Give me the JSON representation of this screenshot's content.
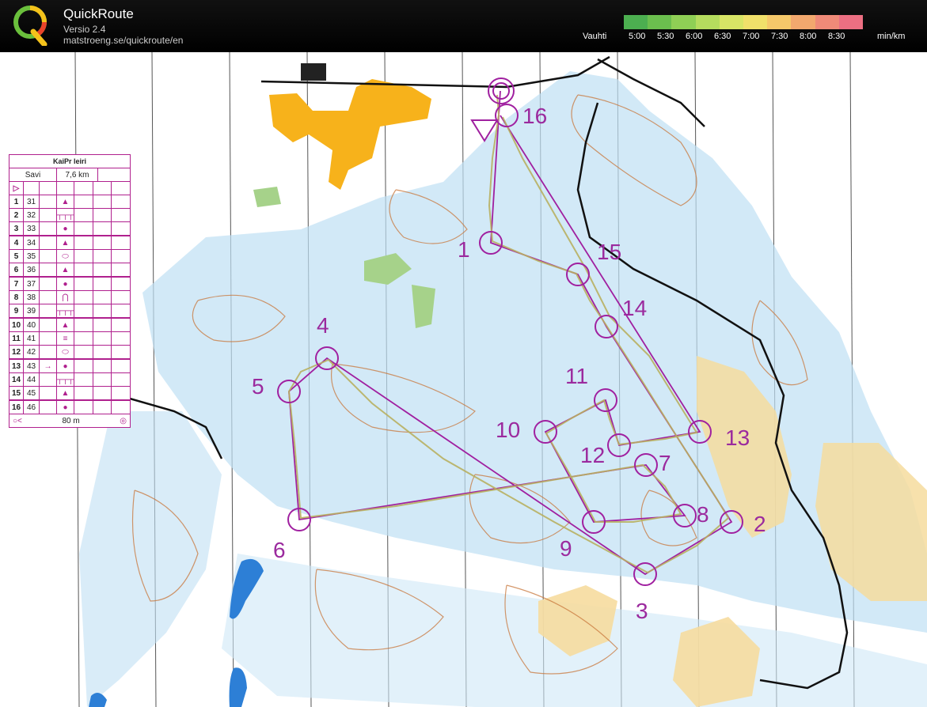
{
  "app": {
    "title": "QuickRoute",
    "version": "Versio 2.4",
    "url": "matstroeng.se/quickroute/en"
  },
  "pace_legend": {
    "label": "Vauhti",
    "ticks": [
      "5:00",
      "5:30",
      "6:00",
      "6:30",
      "7:00",
      "7:30",
      "8:00",
      "8:30"
    ],
    "unit": "min/km",
    "colors": [
      "#4caf50",
      "#6bbf4e",
      "#8fcf55",
      "#b5dc5e",
      "#d8e566",
      "#f0e06a",
      "#f5c86a",
      "#f2a86e",
      "#ef8a78",
      "#ec6f82"
    ]
  },
  "control_card": {
    "event": "KaiPr leiri",
    "course": "Savi",
    "length": "7,6 km",
    "start_symbol": "▷",
    "rows": [
      {
        "num": "1",
        "code": "31",
        "symbol": "▲",
        "extra": ""
      },
      {
        "num": "2",
        "code": "32",
        "symbol": "┬┬┬",
        "extra": ""
      },
      {
        "num": "3",
        "code": "33",
        "symbol": "●",
        "extra": ""
      },
      {
        "num": "4",
        "code": "34",
        "symbol": "▲",
        "extra": ""
      },
      {
        "num": "5",
        "code": "35",
        "symbol": "⬭",
        "extra": ""
      },
      {
        "num": "6",
        "code": "36",
        "symbol": "▲",
        "extra": ""
      },
      {
        "num": "7",
        "code": "37",
        "symbol": "●",
        "extra": ""
      },
      {
        "num": "8",
        "code": "38",
        "symbol": "⋂",
        "extra": ""
      },
      {
        "num": "9",
        "code": "39",
        "symbol": "┬┬┬",
        "extra": ""
      },
      {
        "num": "10",
        "code": "40",
        "symbol": "▲",
        "extra": ""
      },
      {
        "num": "11",
        "code": "41",
        "symbol": "≡",
        "extra": ""
      },
      {
        "num": "12",
        "code": "42",
        "symbol": "⬭",
        "extra": ""
      },
      {
        "num": "13",
        "code": "43",
        "symbol": "●",
        "extra": "→"
      },
      {
        "num": "14",
        "code": "44",
        "symbol": "┬┬┬",
        "extra": ""
      },
      {
        "num": "15",
        "code": "45",
        "symbol": "▲",
        "extra": ""
      },
      {
        "num": "16",
        "code": "46",
        "symbol": "●",
        "extra": ""
      }
    ],
    "finish_distance": "80 m"
  },
  "controls": [
    {
      "label": "1"
    },
    {
      "label": "2"
    },
    {
      "label": "3"
    },
    {
      "label": "4"
    },
    {
      "label": "5"
    },
    {
      "label": "6"
    },
    {
      "label": "7"
    },
    {
      "label": "8"
    },
    {
      "label": "9"
    },
    {
      "label": "10"
    },
    {
      "label": "11"
    },
    {
      "label": "12"
    },
    {
      "label": "13"
    },
    {
      "label": "14"
    },
    {
      "label": "15"
    },
    {
      "label": "16"
    }
  ],
  "colors": {
    "course": "#a020a0",
    "water": "#4a90d9",
    "marsh": "#9fd0ef",
    "contour": "#c8763a",
    "open": "#f7b21b",
    "rough_open": "#f6dc9e",
    "green": "#a6d28a"
  }
}
